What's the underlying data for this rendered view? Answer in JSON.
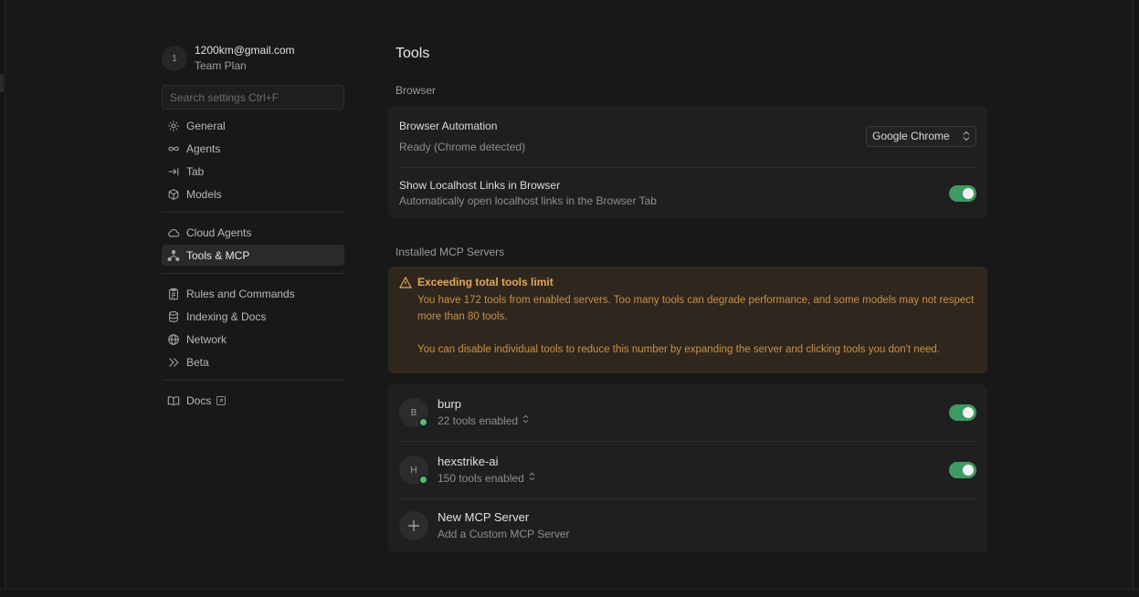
{
  "account": {
    "avatar_initial": "1",
    "email": "1200km@gmail.com",
    "plan": "Team Plan"
  },
  "search": {
    "placeholder": "Search settings Ctrl+F"
  },
  "sidebar": {
    "group1": [
      {
        "label": "General",
        "icon": "gear-icon"
      },
      {
        "label": "Agents",
        "icon": "infinity-icon"
      },
      {
        "label": "Tab",
        "icon": "arrow-right-bar-icon"
      },
      {
        "label": "Models",
        "icon": "cube-icon"
      }
    ],
    "group2": [
      {
        "label": "Cloud Agents",
        "icon": "cloud-icon"
      },
      {
        "label": "Tools & MCP",
        "icon": "nodes-icon",
        "active": true
      }
    ],
    "group3": [
      {
        "label": "Rules and Commands",
        "icon": "clipboard-icon"
      },
      {
        "label": "Indexing & Docs",
        "icon": "database-icon"
      },
      {
        "label": "Network",
        "icon": "globe-icon"
      },
      {
        "label": "Beta",
        "icon": "double-chevron-icon"
      }
    ],
    "docs": {
      "label": "Docs",
      "icon": "book-icon"
    }
  },
  "main": {
    "title": "Tools",
    "browser": {
      "section_label": "Browser",
      "automation_title": "Browser Automation",
      "automation_status": "Ready (Chrome detected)",
      "browser_select": "Google Chrome",
      "localhost_title": "Show Localhost Links in Browser",
      "localhost_desc": "Automatically open localhost links in the Browser Tab",
      "localhost_enabled": true
    },
    "mcp": {
      "section_label": "Installed MCP Servers",
      "warning_title": "Exceeding total tools limit",
      "warning_text1": "You have 172 tools from enabled servers. Too many tools can degrade performance, and some models may not respect more than 80 tools.",
      "warning_text2": "You can disable individual tools to reduce this number by expanding the server and clicking tools you don't need.",
      "servers": [
        {
          "initial": "B",
          "name": "burp",
          "tools": "22 tools enabled",
          "enabled": true
        },
        {
          "initial": "H",
          "name": "hexstrike-ai",
          "tools": "150 tools enabled",
          "enabled": true
        }
      ],
      "new_server_title": "New MCP Server",
      "new_server_desc": "Add a Custom MCP Server"
    }
  },
  "colors": {
    "accent_green": "#3f9a63",
    "warning_bg": "#2f271e",
    "warning_text": "#c98f46"
  }
}
